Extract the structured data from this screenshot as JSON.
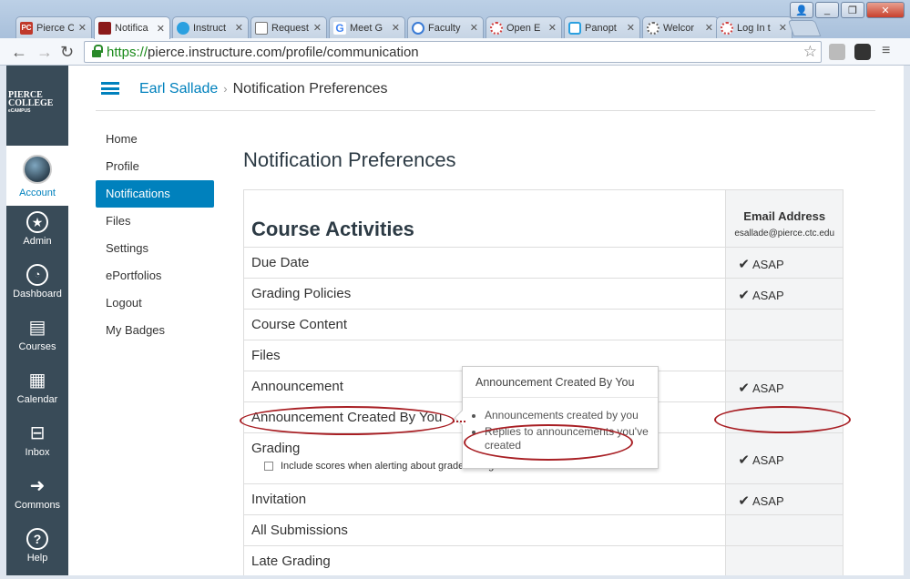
{
  "browser": {
    "tabs": [
      {
        "label": "Pierce C",
        "fav_color": "#c0392b",
        "fav_text": "PC"
      },
      {
        "label": "Notifica",
        "fav_color": "#8b1a1a",
        "fav_text": ""
      },
      {
        "label": "Instruct",
        "fav_color": "#2aa0e0",
        "fav_text": ""
      },
      {
        "label": "Request",
        "fav_color": "#777777",
        "fav_text": ""
      },
      {
        "label": "Meet G",
        "fav_color": "#4285f4",
        "fav_text": "G"
      },
      {
        "label": "Faculty",
        "fav_color": "#3a7bd5",
        "fav_text": ""
      },
      {
        "label": "Open E",
        "fav_color": "#d04040",
        "fav_text": ""
      },
      {
        "label": "Panopt",
        "fav_color": "#2aa0e0",
        "fav_text": ""
      },
      {
        "label": "Welcor",
        "fav_color": "#666666",
        "fav_text": ""
      },
      {
        "label": "Log In t",
        "fav_color": "#d04040",
        "fav_text": ""
      }
    ],
    "url_scheme": "https://",
    "url_rest": "pierce.instructure.com/profile/communication"
  },
  "logo": {
    "line1": "PIERCE",
    "line2": "COLLEGE",
    "line3": "eCAMPUS"
  },
  "global_nav": [
    {
      "label": "Account",
      "icon": "avatar"
    },
    {
      "label": "Admin",
      "icon": "shield-star-icon"
    },
    {
      "label": "Dashboard",
      "icon": "gauge-icon"
    },
    {
      "label": "Courses",
      "icon": "book-icon"
    },
    {
      "label": "Calendar",
      "icon": "calendar-icon"
    },
    {
      "label": "Inbox",
      "icon": "inbox-icon"
    },
    {
      "label": "Commons",
      "icon": "share-icon"
    },
    {
      "label": "Help",
      "icon": "help-icon"
    }
  ],
  "breadcrumb": {
    "user": "Earl Sallade",
    "separator": "›",
    "current": "Notification Preferences"
  },
  "left_nav": [
    "Home",
    "Profile",
    "Notifications",
    "Files",
    "Settings",
    "ePortfolios",
    "Logout",
    "My Badges"
  ],
  "page_title": "Notification Preferences",
  "table": {
    "section_title": "Course Activities",
    "column_title": "Email Address",
    "column_email": "esallade@pierce.ctc.edu",
    "rows": [
      {
        "label": "Due Date",
        "value": "ASAP"
      },
      {
        "label": "Grading Policies",
        "value": "ASAP"
      },
      {
        "label": "Course Content",
        "value": ""
      },
      {
        "label": "Files",
        "value": ""
      },
      {
        "label": "Announcement",
        "value": "ASAP"
      },
      {
        "label": "Announcement Created By You",
        "value": ""
      },
      {
        "label": "Grading",
        "value": "ASAP",
        "sub_option": "Include scores when alerting about grade changes."
      },
      {
        "label": "Invitation",
        "value": "ASAP"
      },
      {
        "label": "All Submissions",
        "value": ""
      },
      {
        "label": "Late Grading",
        "value": ""
      }
    ]
  },
  "popover": {
    "title": "Announcement Created By You",
    "items": [
      "Announcements created by you",
      "Replies to announcements you've created"
    ]
  },
  "colors": {
    "accent": "#0081bd",
    "nav_bg": "#394b58",
    "annotation": "#a81f24"
  }
}
